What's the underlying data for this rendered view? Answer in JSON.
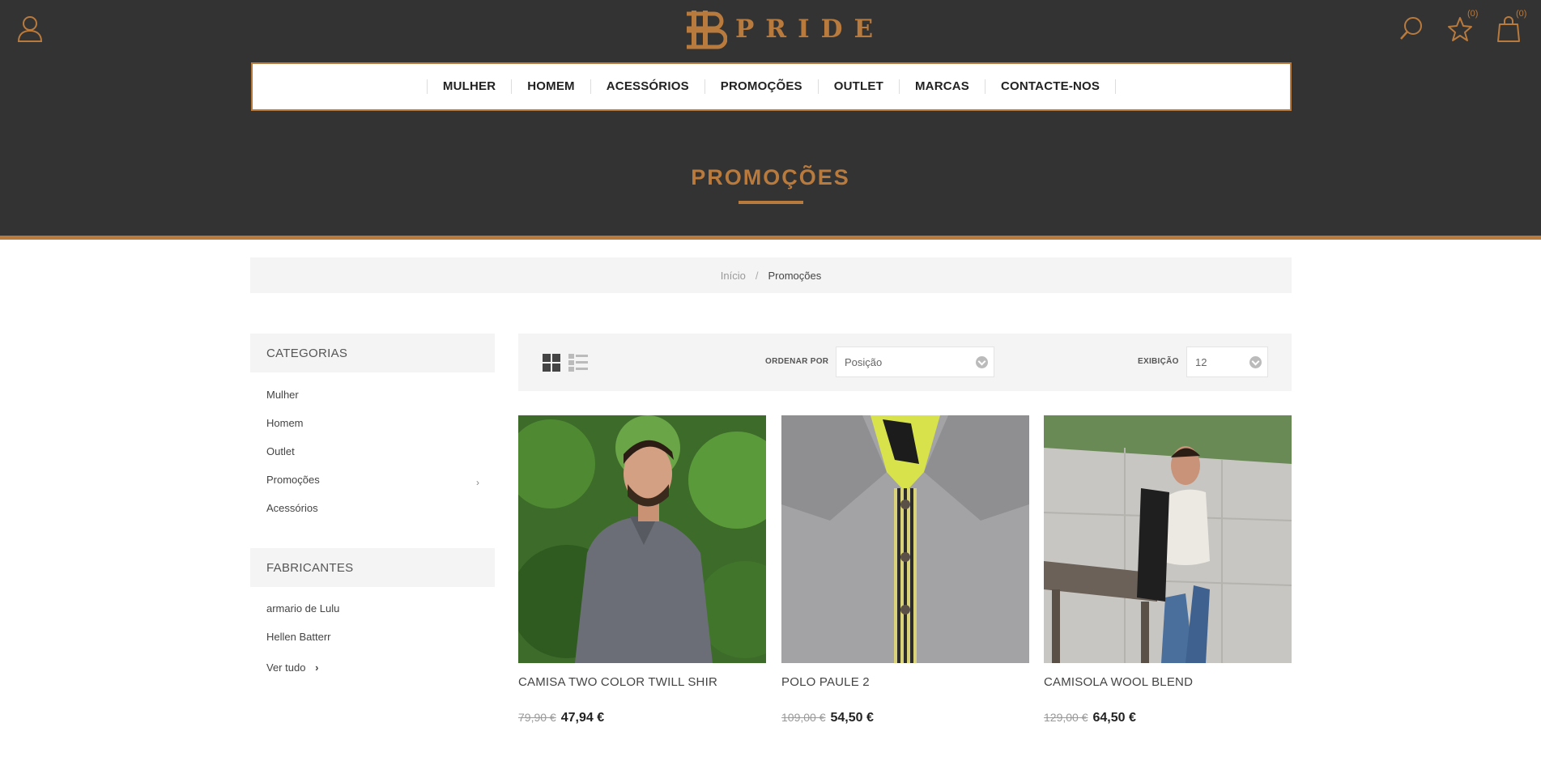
{
  "header": {
    "brand": "PRIDE",
    "wishlist_count": "(0)",
    "cart_count": "(0)",
    "icons": [
      "user-icon",
      "search-icon",
      "star-icon",
      "shopping-bag-icon"
    ]
  },
  "nav": {
    "items": [
      {
        "label": "MULHER"
      },
      {
        "label": "HOMEM"
      },
      {
        "label": "ACESSÓRIOS"
      },
      {
        "label": "PROMOÇÕES"
      },
      {
        "label": "OUTLET"
      },
      {
        "label": "MARCAS"
      },
      {
        "label": "CONTACTE-NOS"
      }
    ]
  },
  "page_title": "PROMOÇÕES",
  "breadcrumb": {
    "home": "Início",
    "separator": "/",
    "current": "Promoções"
  },
  "sidebar": {
    "categories_title": "CATEGORIAS",
    "categories": [
      {
        "label": "Mulher"
      },
      {
        "label": "Homem"
      },
      {
        "label": "Outlet"
      },
      {
        "label": "Promoções"
      },
      {
        "label": "Acessórios"
      }
    ],
    "manufacturers_title": "FABRICANTES",
    "manufacturers": [
      {
        "label": "armario de Lulu"
      },
      {
        "label": "Hellen Batterr"
      }
    ],
    "see_all": "Ver tudo"
  },
  "toolbar": {
    "sort_label": "ORDENAR POR",
    "sort_value": "Posição",
    "show_label": "EXIBIÇÃO",
    "show_value": "12"
  },
  "products": [
    {
      "name": "CAMISA TWO COLOR TWILL SHIR",
      "old_price": "79,90 €",
      "price": "47,94 €"
    },
    {
      "name": "POLO PAULE 2",
      "old_price": "109,00 €",
      "price": "54,50 €"
    },
    {
      "name": "CAMISOLA WOOL BLEND",
      "old_price": "129,00 €",
      "price": "64,50 €"
    }
  ],
  "colors": {
    "accent": "#b87a3d",
    "header_bg": "#333333",
    "panel_bg": "#f4f4f4"
  }
}
